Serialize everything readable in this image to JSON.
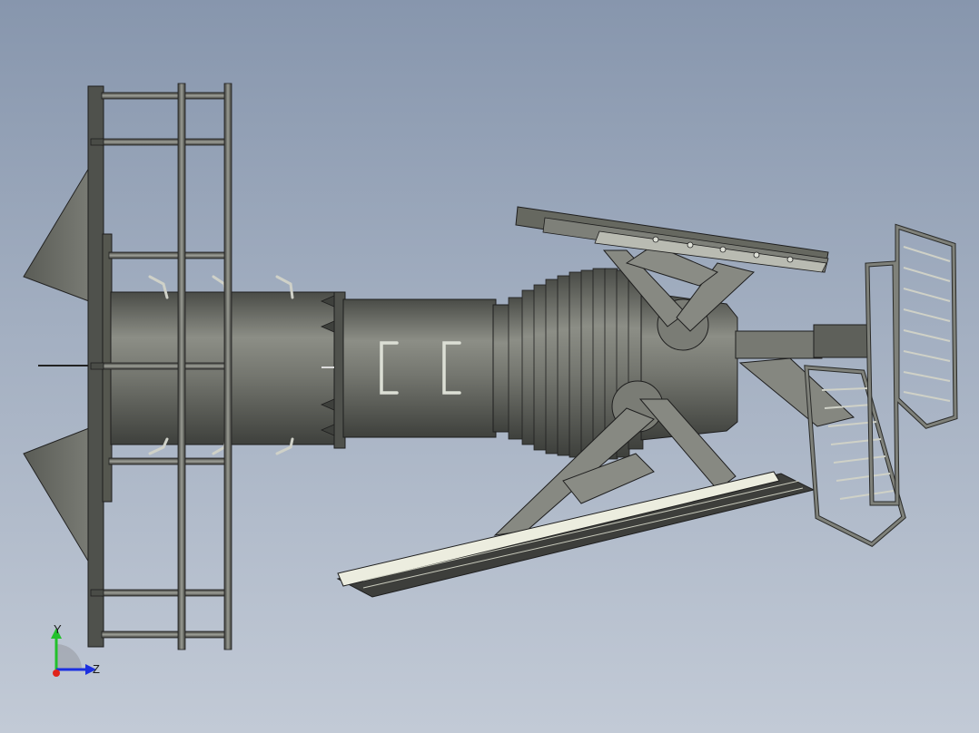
{
  "viewport": {
    "background_top": "#8796ad",
    "background_bottom": "#c2cad6"
  },
  "model": {
    "body_color": "#6e7069",
    "panel_color": "#eceddf",
    "edge_color": "#1e1e1e"
  },
  "triad": {
    "y_label": "Y",
    "z_label": "Z",
    "y_color": "#22c12b",
    "z_color": "#1b2fe0",
    "x_color": "#e0241b"
  }
}
